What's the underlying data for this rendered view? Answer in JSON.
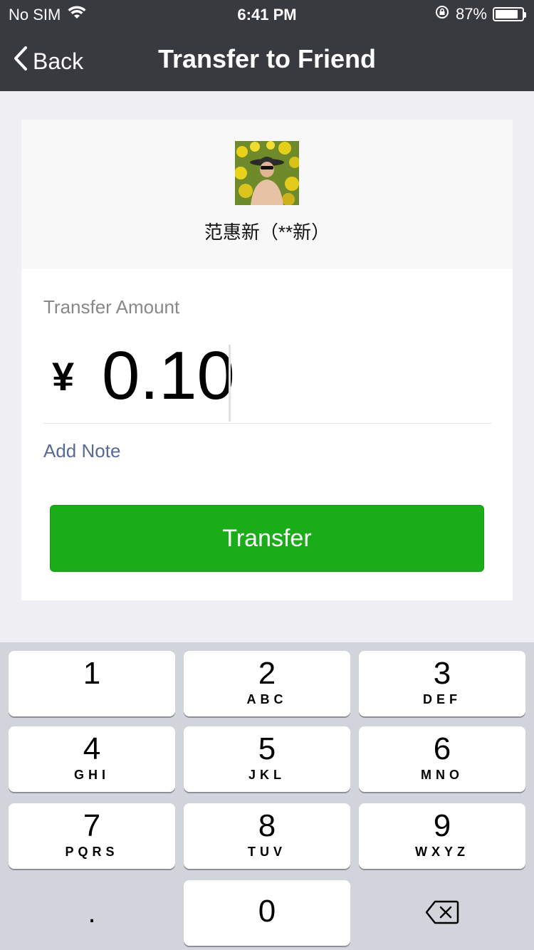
{
  "status_bar": {
    "carrier": "No SIM",
    "time": "6:41 PM",
    "battery_percent": "87%",
    "battery_level": 0.87
  },
  "nav": {
    "back_label": "Back",
    "title": "Transfer to Friend"
  },
  "recipient": {
    "name": "范惠新（**新）"
  },
  "amount": {
    "label": "Transfer Amount",
    "currency_symbol": "¥",
    "value": "0.10"
  },
  "add_note_label": "Add Note",
  "transfer_button_label": "Transfer",
  "colors": {
    "nav_bg": "#393a3f",
    "transfer_green": "#1aad19",
    "link_blue": "#576b95"
  },
  "keypad": {
    "keys": [
      {
        "digit": "1",
        "letters": ""
      },
      {
        "digit": "2",
        "letters": "ABC"
      },
      {
        "digit": "3",
        "letters": "DEF"
      },
      {
        "digit": "4",
        "letters": "GHI"
      },
      {
        "digit": "5",
        "letters": "JKL"
      },
      {
        "digit": "6",
        "letters": "MNO"
      },
      {
        "digit": "7",
        "letters": "PQRS"
      },
      {
        "digit": "8",
        "letters": "TUV"
      },
      {
        "digit": "9",
        "letters": "WXYZ"
      },
      {
        "digit": "0",
        "letters": ""
      }
    ],
    "decimal_label": ".",
    "delete_icon": "backspace-icon"
  }
}
